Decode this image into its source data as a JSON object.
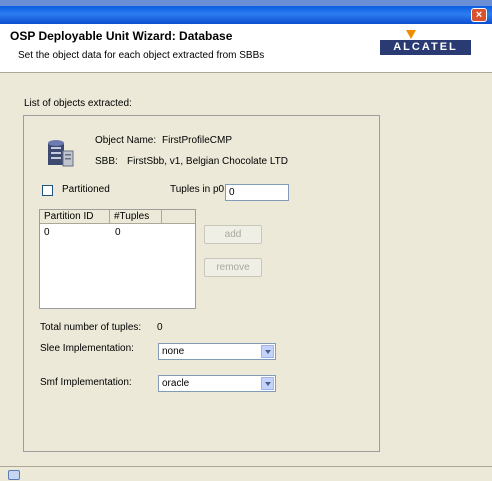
{
  "window": {
    "title": "OSP Deployable Unit Wizard: Database",
    "subtitle": "Set the object data for each object extracted from SBBs",
    "close_glyph": "×",
    "logo_text": "ALCATEL"
  },
  "content": {
    "list_label": "List of objects extracted:",
    "object_name_label": "Object Name:",
    "object_name_value": "FirstProfileCMP",
    "sbb_label": "SBB:",
    "sbb_value": "FirstSbb, v1, Belgian Chocolate LTD",
    "partitioned_label": "Partitioned",
    "partitioned_checked": false,
    "tuples_label": "Tuples in p0:",
    "tuples_value": "0",
    "table": {
      "columns": [
        "Partition ID",
        "#Tuples"
      ],
      "rows": [
        [
          "0",
          "0"
        ]
      ]
    },
    "add_label": "add",
    "remove_label": "remove",
    "total_label": "Total number of tuples:",
    "total_value": "0",
    "slee_label": "Slee Implementation:",
    "slee_value": "none",
    "smf_label": "Smf Implementation:",
    "smf_value": "oracle"
  },
  "icons": {
    "database": "database-icon",
    "close": "close-icon",
    "logo": "alcatel-logo"
  },
  "colors": {
    "titlebar": "#0a5fe0",
    "logo_bg": "#2a3a72",
    "logo_mark": "#f08c00",
    "panel": "#ece9d8"
  }
}
